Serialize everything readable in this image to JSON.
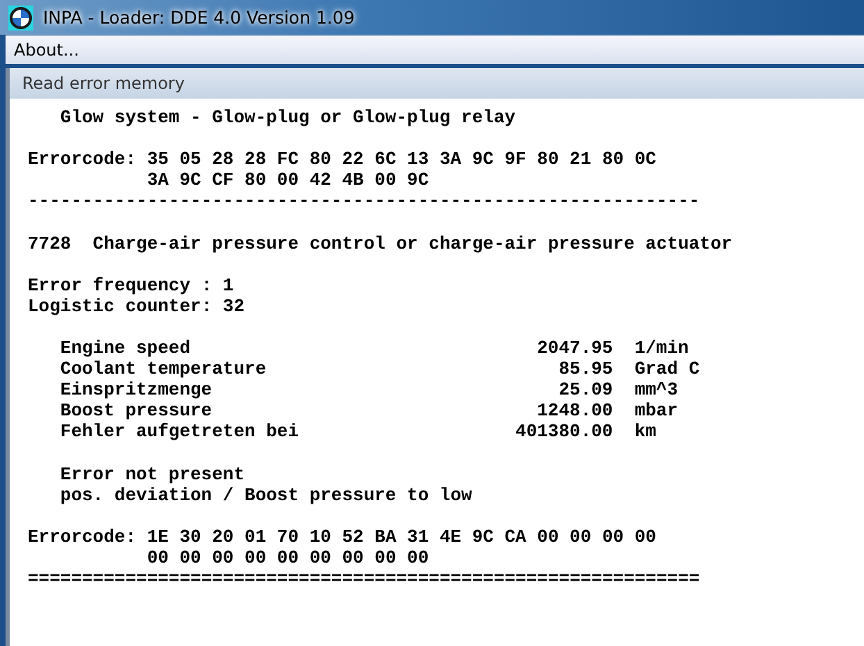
{
  "window": {
    "title": "INPA - Loader:  DDE 4.0 Version 1.09"
  },
  "menu": [
    "About..."
  ],
  "panel": {
    "title": "Read error memory"
  },
  "lines": [
    {
      "kind": "indented",
      "text": "Glow system - Glow-plug or Glow-plug relay"
    },
    {
      "kind": "blank"
    },
    {
      "kind": "code",
      "label": "Errorcode:",
      "bytes": [
        "35 05 28 28 FC 80 22 6C 13 3A 9C 9F 80 21 80 0C",
        "3A 9C CF 80 00 42 4B 00 9C"
      ]
    },
    {
      "kind": "plain",
      "text": "--------------------------------------------------------------"
    },
    {
      "kind": "blank"
    },
    {
      "kind": "plain",
      "text": "7728  Charge-air pressure control or charge-air pressure actuator"
    },
    {
      "kind": "blank"
    },
    {
      "kind": "plain",
      "text": "Error frequency : 1"
    },
    {
      "kind": "plain",
      "text": "Logistic counter: 32"
    },
    {
      "kind": "blank"
    },
    {
      "kind": "value",
      "label": "Engine speed",
      "value": "2047.95",
      "unit": "1/min"
    },
    {
      "kind": "value",
      "label": "Coolant temperature",
      "value": "85.95",
      "unit": "Grad C"
    },
    {
      "kind": "value",
      "label": "Einspritzmenge",
      "value": "25.09",
      "unit": "mm^3"
    },
    {
      "kind": "value",
      "label": "Boost pressure",
      "value": "1248.00",
      "unit": "mbar"
    },
    {
      "kind": "value",
      "label": "Fehler aufgetreten bei",
      "value": "401380.00",
      "unit": "km"
    },
    {
      "kind": "blank"
    },
    {
      "kind": "indented",
      "text": "Error not present"
    },
    {
      "kind": "indented",
      "text": "pos. deviation / Boost pressure to low"
    },
    {
      "kind": "blank"
    },
    {
      "kind": "code",
      "label": "Errorcode:",
      "bytes": [
        "1E 30 20 01 70 10 52 BA 31 4E 9C CA 00 00 00 00",
        "00 00 00 00 00 00 00 00 00"
      ]
    },
    {
      "kind": "plain",
      "text": "=============================================================="
    }
  ]
}
